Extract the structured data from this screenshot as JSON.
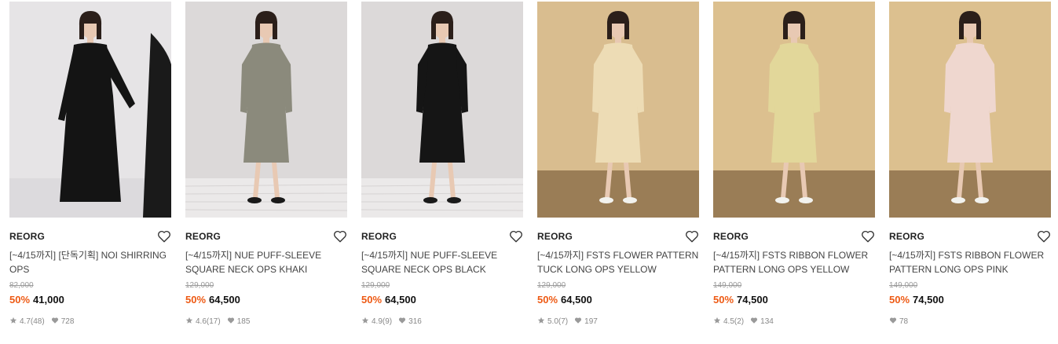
{
  "products": [
    {
      "brand": "REORG",
      "title": "[~4/15까지] [단독기획] NOI SHIRRING OPS",
      "original_price": "82,000",
      "discount": "50%",
      "price": "41,000",
      "rating": "4.7",
      "reviews": "(48)",
      "likes": "728",
      "dress_color": "#141414",
      "bg_color": "#e6e4e6",
      "floor_color": "#dcdadd"
    },
    {
      "brand": "REORG",
      "title": "[~4/15까지] NUE PUFF-SLEEVE SQUARE NECK OPS KHAKI",
      "original_price": "129,000",
      "discount": "50%",
      "price": "64,500",
      "rating": "4.6",
      "reviews": "(17)",
      "likes": "185",
      "dress_color": "#8b8a7c",
      "bg_color": "#dcd9d9",
      "floor_color": "#ebe9e9"
    },
    {
      "brand": "REORG",
      "title": "[~4/15까지] NUE PUFF-SLEEVE SQUARE NECK OPS BLACK",
      "original_price": "129,000",
      "discount": "50%",
      "price": "64,500",
      "rating": "4.9",
      "reviews": "(9)",
      "likes": "316",
      "dress_color": "#151515",
      "bg_color": "#dcd9d9",
      "floor_color": "#ebe9e9"
    },
    {
      "brand": "REORG",
      "title": "[~4/15까지] FSTS FLOWER PATTERN TUCK LONG OPS YELLOW",
      "original_price": "129,000",
      "discount": "50%",
      "price": "64,500",
      "rating": "5.0",
      "reviews": "(7)",
      "likes": "197",
      "dress_color": "#eddcb5",
      "bg_color": "#d9bd8f",
      "floor_color": "#9a7d56"
    },
    {
      "brand": "REORG",
      "title": "[~4/15까지] FSTS RIBBON FLOWER PATTERN LONG OPS YELLOW",
      "original_price": "149,000",
      "discount": "50%",
      "price": "74,500",
      "rating": "4.5",
      "reviews": "(2)",
      "likes": "134",
      "dress_color": "#e2d79a",
      "bg_color": "#dcc08f",
      "floor_color": "#9a7d56"
    },
    {
      "brand": "REORG",
      "title": "[~4/15까지] FSTS RIBBON FLOWER PATTERN LONG OPS PINK",
      "original_price": "149,000",
      "discount": "50%",
      "price": "74,500",
      "rating": "",
      "reviews": "",
      "likes": "78",
      "dress_color": "#efd7cf",
      "bg_color": "#dcc08f",
      "floor_color": "#9a7d56"
    }
  ],
  "icons": {
    "heart": "heart-outline-icon",
    "star": "star-icon",
    "like": "heart-filled-icon"
  },
  "colors": {
    "discount": "#ee5a14",
    "meta": "#888888"
  }
}
